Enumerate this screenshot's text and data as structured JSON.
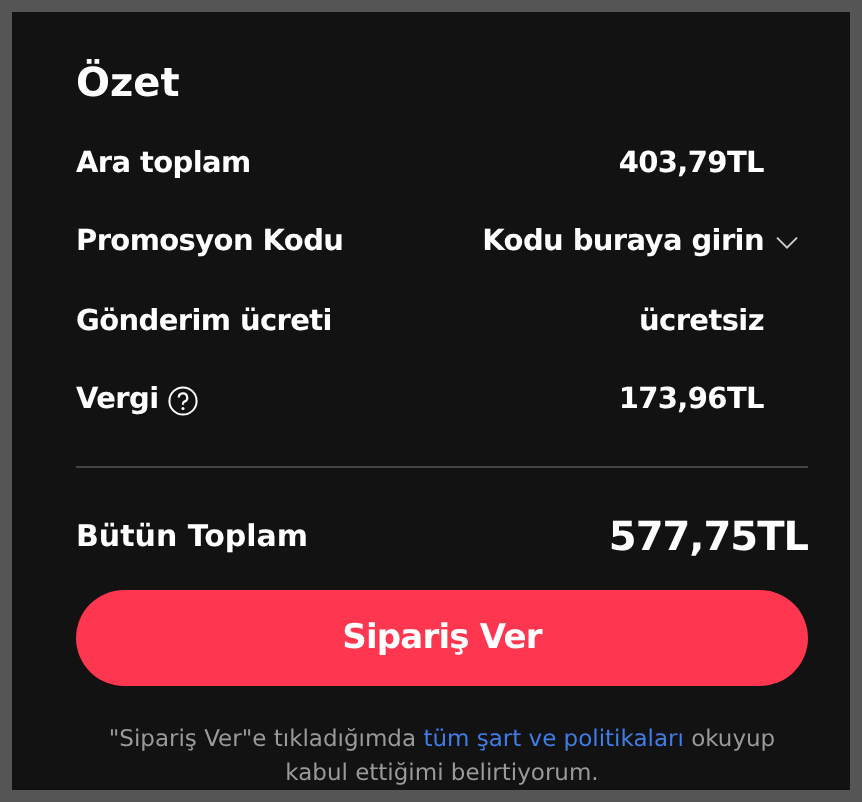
{
  "title": "Özet",
  "rows": [
    {
      "kind": "plain",
      "label": "Ara toplam",
      "value": "403,79TL"
    },
    {
      "kind": "dropdown",
      "label": "Promosyon Kodu",
      "value": "Kodu buraya girin"
    },
    {
      "kind": "plain",
      "label": "Gönderim ücreti",
      "value": "ücretsiz"
    },
    {
      "kind": "help",
      "label": "Vergi",
      "value": "173,96TL"
    }
  ],
  "total": {
    "label": "Bütün Toplam",
    "value": "577,75TL"
  },
  "button": "Sipariş Ver",
  "notice": {
    "before": "\"Sipariş Ver\"e tıkladığımda",
    "link": "tüm şart ve politikaları",
    "after": "okuyup kabul ettiğimi belirtiyorum."
  }
}
